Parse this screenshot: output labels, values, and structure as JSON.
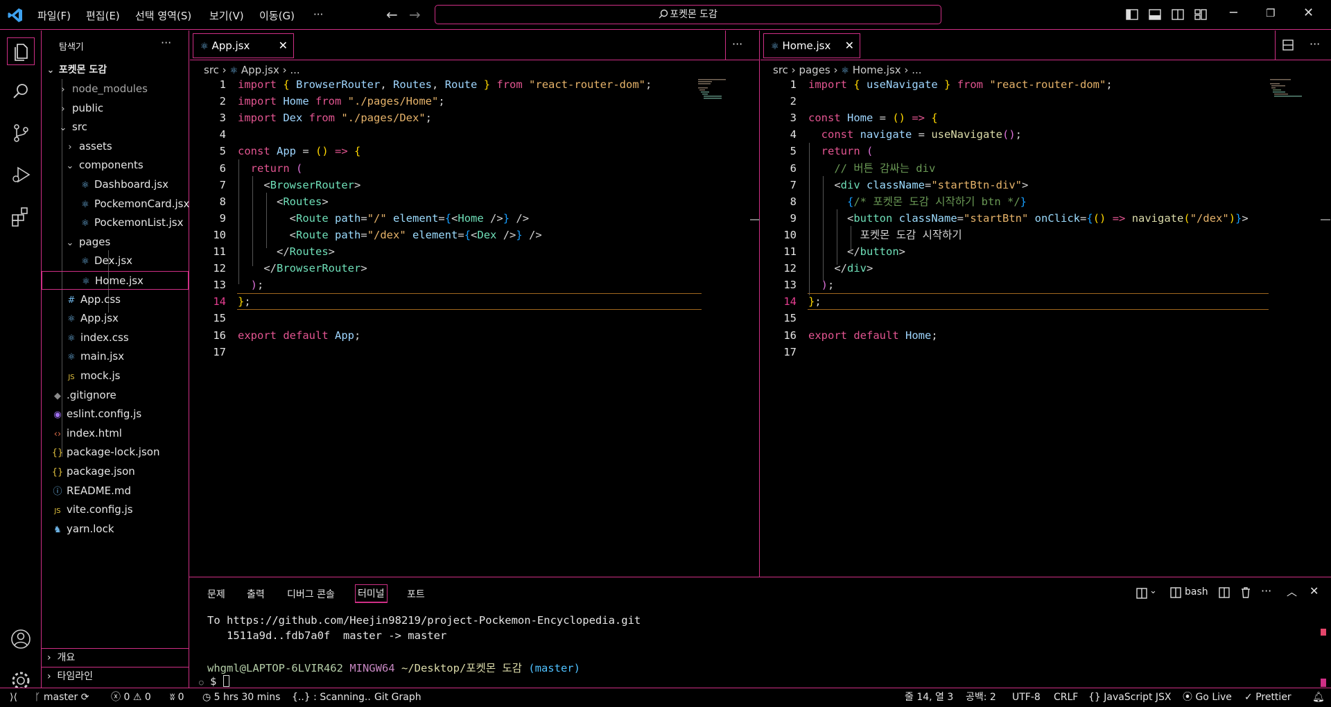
{
  "titlebar": {
    "menus": [
      "파일(F)",
      "편집(E)",
      "선택 영역(S)",
      "보기(V)",
      "이동(G)"
    ],
    "more": "···",
    "back": "←",
    "forward": "→",
    "search_text": "포켓몬 도감"
  },
  "sidebar": {
    "title": "탐색기",
    "more": "···",
    "root": "포켓몬 도감",
    "items": [
      {
        "label": "node_modules",
        "kind": "folder-collapsed"
      },
      {
        "label": "public",
        "kind": "folder-collapsed"
      },
      {
        "label": "src",
        "kind": "folder-open"
      },
      {
        "label": "assets",
        "kind": "folder-collapsed"
      },
      {
        "label": "components",
        "kind": "folder-open"
      },
      {
        "label": "Dashboard.jsx",
        "kind": "react"
      },
      {
        "label": "PockemonCard.jsx",
        "kind": "react"
      },
      {
        "label": "PockemonList.jsx",
        "kind": "react"
      },
      {
        "label": "pages",
        "kind": "folder-open"
      },
      {
        "label": "Dex.jsx",
        "kind": "react"
      },
      {
        "label": "Home.jsx",
        "kind": "react"
      },
      {
        "label": "App.css",
        "kind": "css"
      },
      {
        "label": "App.jsx",
        "kind": "react"
      },
      {
        "label": "index.css",
        "kind": "react"
      },
      {
        "label": "main.jsx",
        "kind": "react"
      },
      {
        "label": "mock.js",
        "kind": "js"
      },
      {
        "label": ".gitignore",
        "kind": "git"
      },
      {
        "label": "eslint.config.js",
        "kind": "eslint"
      },
      {
        "label": "index.html",
        "kind": "html"
      },
      {
        "label": "package-lock.json",
        "kind": "json"
      },
      {
        "label": "package.json",
        "kind": "json"
      },
      {
        "label": "README.md",
        "kind": "info"
      },
      {
        "label": "vite.config.js",
        "kind": "js"
      },
      {
        "label": "yarn.lock",
        "kind": "yarn"
      }
    ],
    "outline": "개요",
    "timeline": "타임라인"
  },
  "editor_left": {
    "tab": "App.jsx",
    "breadcrumb": [
      "src",
      "App.jsx",
      "..."
    ],
    "current_line": 14
  },
  "editor_right": {
    "tab": "Home.jsx",
    "breadcrumb": [
      "src",
      "pages",
      "Home.jsx",
      "..."
    ],
    "current_line": 14
  },
  "panel": {
    "tabs": [
      "문제",
      "출력",
      "디버그 콘솔",
      "터미널",
      "포트"
    ],
    "active_tab": "터미널",
    "shell": "bash",
    "terminal": {
      "line1": "To https://github.com/Heejin98219/project-Pockemon-Encyclopedia.git",
      "line2": "   1511a9d..fdb7a0f  master -> master",
      "prompt_user": "whgml@LAPTOP-6LVIR462",
      "prompt_env": "MINGW64",
      "prompt_path": "~/Desktop/포켓몬 도감",
      "prompt_branch": "(master)",
      "prompt_symbol": "$"
    }
  },
  "statusbar": {
    "branch": "master",
    "errors": "0",
    "warnings": "0",
    "ports": "0",
    "time": "5 hrs 30 mins",
    "scanning": "{..} : Scanning..",
    "git_graph": "Git Graph",
    "position": "줄 14, 열 3",
    "spaces": "공백: 2",
    "encoding": "UTF-8",
    "eol": "CRLF",
    "language": "JavaScript JSX",
    "golive": "Go Live",
    "prettier": "Prettier"
  },
  "colors": {
    "accent": "#d02f86",
    "background": "#000000"
  }
}
